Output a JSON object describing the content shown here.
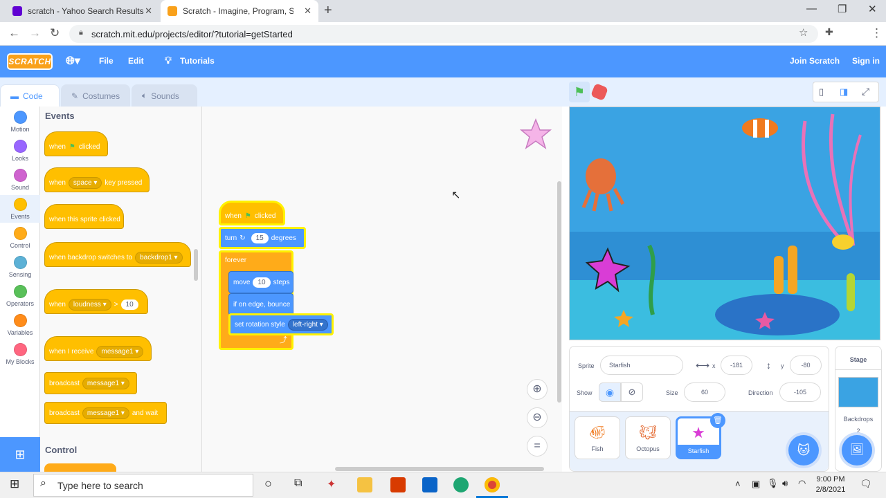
{
  "browser": {
    "tabs": [
      {
        "title": "scratch - Yahoo Search Results",
        "fav_color": "#6001d2"
      },
      {
        "title": "Scratch - Imagine, Program, Shar",
        "fav_color": "#f9a11b"
      }
    ],
    "url": "scratch.mit.edu/projects/editor/?tutorial=getStarted"
  },
  "menu": {
    "logo": "SCRATCH",
    "file": "File",
    "edit": "Edit",
    "tutorials": "Tutorials",
    "join": "Join Scratch",
    "signin": "Sign in"
  },
  "editor_tabs": {
    "code": "Code",
    "costumes": "Costumes",
    "sounds": "Sounds"
  },
  "categories": [
    {
      "label": "Motion",
      "color": "#4c97ff"
    },
    {
      "label": "Looks",
      "color": "#9966ff"
    },
    {
      "label": "Sound",
      "color": "#cf63cf"
    },
    {
      "label": "Events",
      "color": "#ffbf00"
    },
    {
      "label": "Control",
      "color": "#ffab19"
    },
    {
      "label": "Sensing",
      "color": "#5cb1d6"
    },
    {
      "label": "Operators",
      "color": "#59c059"
    },
    {
      "label": "Variables",
      "color": "#ff8c1a"
    },
    {
      "label": "My Blocks",
      "color": "#ff6680"
    }
  ],
  "palette": {
    "events_title": "Events",
    "control_title": "Control",
    "b1": {
      "when": "when",
      "clicked": "clicked"
    },
    "b2": {
      "when": "when",
      "key": "space",
      "pressed": "key pressed"
    },
    "b3": "when this sprite clicked",
    "b4": {
      "text": "when backdrop switches to",
      "drop": "backdrop1"
    },
    "b5": {
      "when": "when",
      "drop": "loudness",
      "op": ">",
      "val": "10"
    },
    "b6": {
      "text": "when I receive",
      "drop": "message1"
    },
    "b7": {
      "text": "broadcast",
      "drop": "message1"
    },
    "b8": {
      "text": "broadcast",
      "drop": "message1",
      "tail": "and wait"
    }
  },
  "script": {
    "when": "when",
    "clicked": "clicked",
    "turn": "turn",
    "turn_val": "15",
    "degrees": "degrees",
    "forever": "forever",
    "move": "move",
    "move_val": "10",
    "steps": "steps",
    "bounce": "if on edge, bounce",
    "rot": "set rotation style",
    "rot_val": "left-right"
  },
  "sprite_info": {
    "sprite_label": "Sprite",
    "sprite_name": "Starfish",
    "x_label": "x",
    "x": "-181",
    "y_label": "y",
    "y": "-80",
    "show_label": "Show",
    "size_label": "Size",
    "size": "60",
    "dir_label": "Direction",
    "dir": "-105"
  },
  "sprites": [
    "Fish",
    "Octopus",
    "Starfish"
  ],
  "stage_pane": {
    "title": "Stage",
    "backdrops": "Backdrops",
    "count": "2"
  },
  "taskbar": {
    "search": "Type here to search",
    "time": "9:00 PM",
    "date": "2/8/2021"
  }
}
